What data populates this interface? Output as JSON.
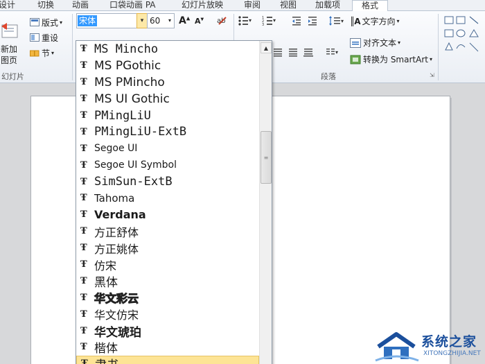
{
  "tabs": [
    {
      "label": "设计",
      "active": false
    },
    {
      "label": "切换",
      "active": false
    },
    {
      "label": "动画",
      "active": false
    },
    {
      "label": "口袋动画 PA",
      "active": false
    },
    {
      "label": "幻灯片放映",
      "active": false
    },
    {
      "label": "审阅",
      "active": false
    },
    {
      "label": "视图",
      "active": false
    },
    {
      "label": "加载项",
      "active": false
    },
    {
      "label": "格式",
      "active": true
    }
  ],
  "slides_group": {
    "new_slide_label_1": "新加",
    "new_slide_label_2": "图页",
    "layout_label": "版式",
    "reset_label": "重设",
    "section_label": "节",
    "group_label": "幻灯片"
  },
  "font": {
    "current_font": "宋体",
    "current_size": "60"
  },
  "paragraph": {
    "text_direction_label": "文字方向",
    "align_text_label": "对齐文本",
    "smartart_label": "转换为 SmartArt",
    "group_label": "段落"
  },
  "font_list": [
    {
      "name": "MS Mincho",
      "family": "DejaVu Sans Mono",
      "size": 17
    },
    {
      "name": "MS PGothic",
      "family": "DejaVu Sans",
      "size": 17
    },
    {
      "name": "MS PMincho",
      "family": "DejaVu Sans",
      "size": 17
    },
    {
      "name": "MS UI Gothic",
      "family": "DejaVu Sans",
      "size": 17
    },
    {
      "name": "PMingLiU",
      "family": "DejaVu Sans Mono",
      "size": 17
    },
    {
      "name": "PMingLiU-ExtB",
      "family": "DejaVu Sans Mono",
      "size": 17
    },
    {
      "name": "Segoe UI",
      "family": "DejaVu Sans",
      "size": 14
    },
    {
      "name": "Segoe UI Symbol",
      "family": "DejaVu Sans",
      "size": 14
    },
    {
      "name": "SimSun-ExtB",
      "family": "DejaVu Sans Mono",
      "size": 17
    },
    {
      "name": "Tahoma",
      "family": "DejaVu Sans",
      "size": 15
    },
    {
      "name": "Verdana",
      "family": "DejaVu Sans",
      "size": 16,
      "bold": true
    },
    {
      "name": "方正舒体",
      "family": "DejaVu Serif",
      "size": 16
    },
    {
      "name": "方正姚体",
      "family": "DejaVu Serif",
      "size": 16
    },
    {
      "name": "仿宋",
      "family": "DejaVu Serif",
      "size": 16
    },
    {
      "name": "黑体",
      "family": "DejaVu Sans",
      "size": 17
    },
    {
      "name": "华文彩云",
      "family": "DejaVu Sans",
      "size": 16,
      "outline": true
    },
    {
      "name": "华文仿宋",
      "family": "DejaVu Serif",
      "size": 16
    },
    {
      "name": "华文琥珀",
      "family": "DejaVu Sans",
      "size": 17,
      "bold": true
    },
    {
      "name": "楷体",
      "family": "DejaVu Serif",
      "size": 17
    },
    {
      "name": "隶书",
      "family": "DejaVu Serif",
      "size": 17,
      "highlight": true
    }
  ],
  "watermark": {
    "title": "系统之家",
    "url": "XITONGZHIJIA.NET"
  },
  "colors": {
    "selection": "#3399ff",
    "hover": "#fde495",
    "brand": "#1b4f9c"
  }
}
